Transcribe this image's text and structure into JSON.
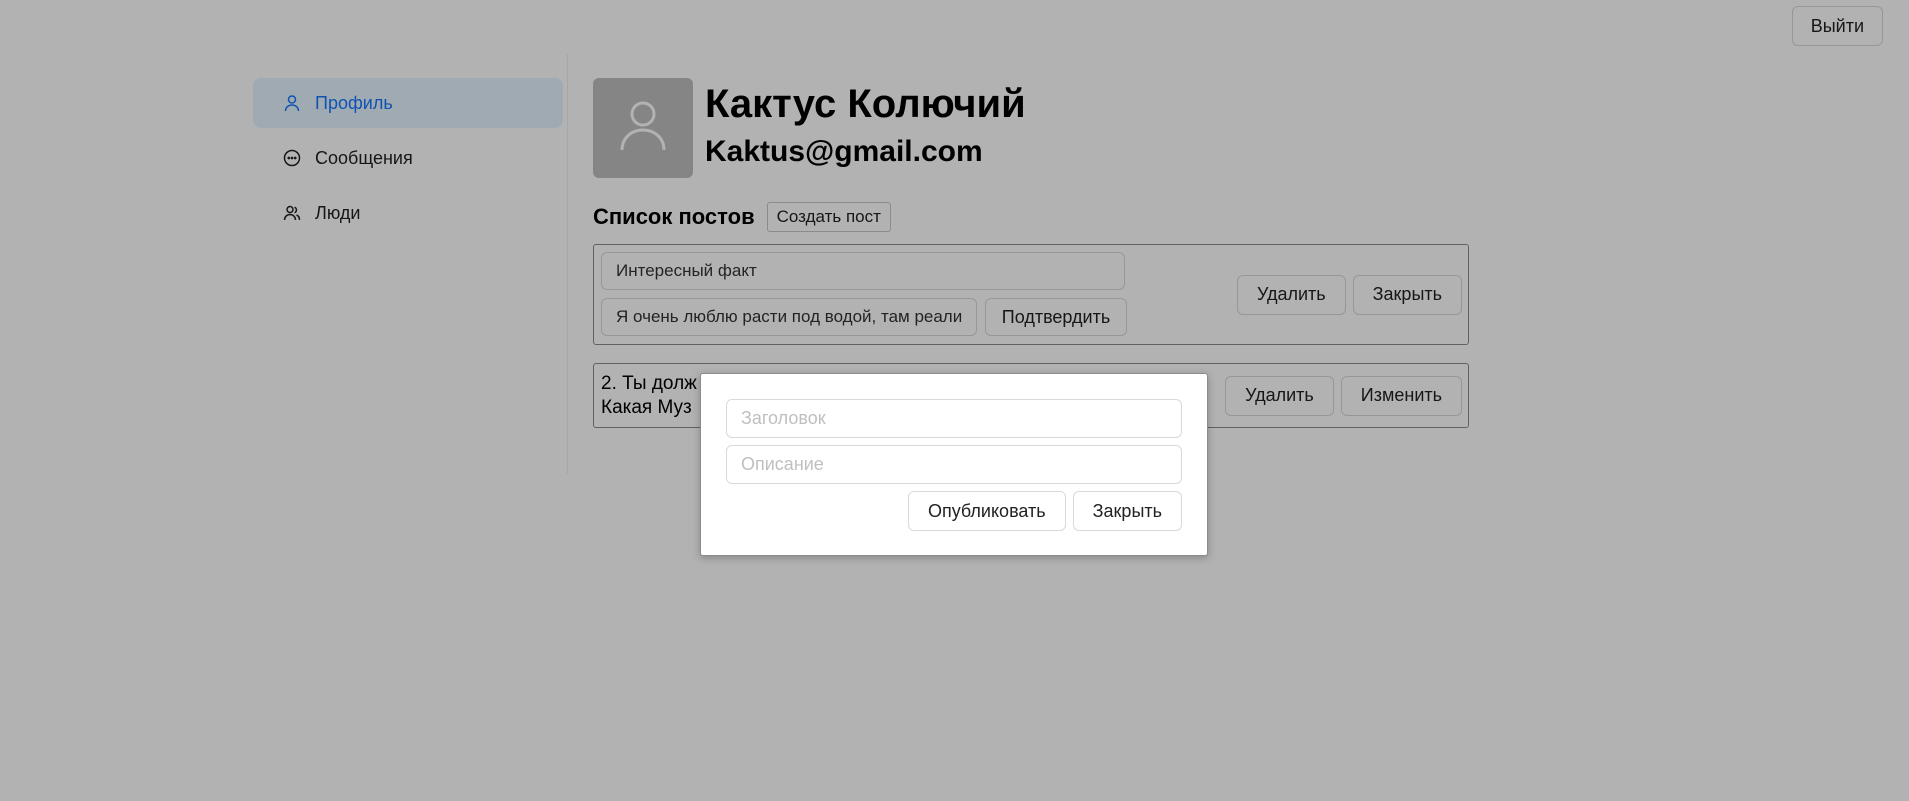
{
  "header": {
    "logout_label": "Выйти"
  },
  "sidebar": {
    "items": [
      {
        "label": "Профиль",
        "icon": "user-icon",
        "active": true
      },
      {
        "label": "Сообщения",
        "icon": "message-icon",
        "active": false
      },
      {
        "label": "Люди",
        "icon": "people-icon",
        "active": false
      }
    ]
  },
  "profile": {
    "name": "Кактус Колючий",
    "email": "Kaktus@gmail.com",
    "avatar_icon": "avatar-user-icon"
  },
  "posts": {
    "title": "Список постов",
    "create_label": "Создать пост",
    "edit_card": {
      "title_value": "Интересный факт",
      "body_value": "Я очень люблю расти под водой, там реали",
      "confirm_label": "Подтвердить",
      "delete_label": "Удалить",
      "close_label": "Закрыть"
    },
    "view_card": {
      "line1": "2. Ты долж",
      "line2": "Какая Муз",
      "delete_label": "Удалить",
      "edit_label": "Изменить"
    }
  },
  "modal": {
    "title_placeholder": "Заголовок",
    "description_placeholder": "Описание",
    "publish_label": "Опубликовать",
    "close_label": "Закрыть"
  },
  "colors": {
    "accent": "#1677ff",
    "active_bg": "#e6f4ff",
    "overlay": "rgba(0,0,0,0.3)"
  }
}
